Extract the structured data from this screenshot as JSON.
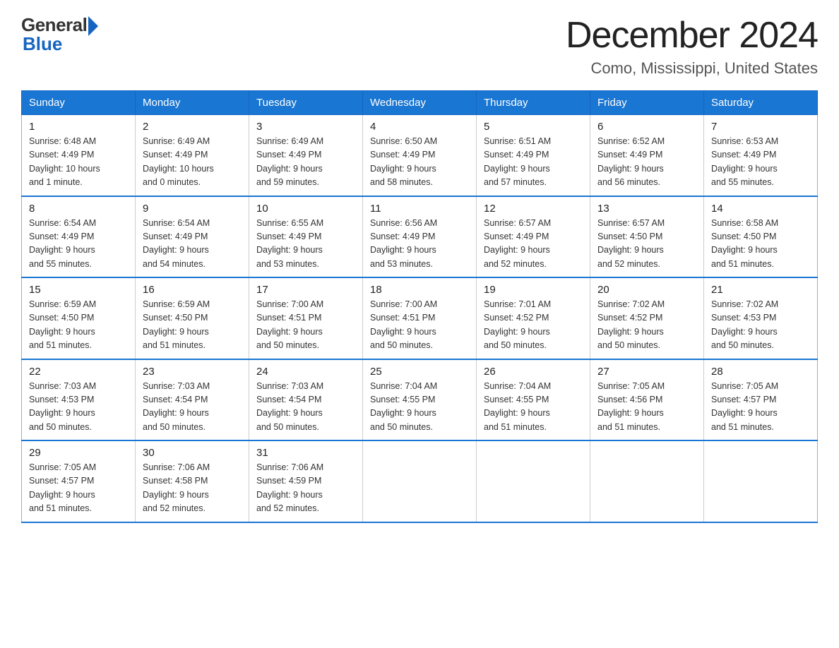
{
  "logo": {
    "general": "General",
    "blue": "Blue"
  },
  "header": {
    "month": "December 2024",
    "location": "Como, Mississippi, United States"
  },
  "weekdays": [
    "Sunday",
    "Monday",
    "Tuesday",
    "Wednesday",
    "Thursday",
    "Friday",
    "Saturday"
  ],
  "weeks": [
    [
      {
        "day": "1",
        "info": "Sunrise: 6:48 AM\nSunset: 4:49 PM\nDaylight: 10 hours\nand 1 minute."
      },
      {
        "day": "2",
        "info": "Sunrise: 6:49 AM\nSunset: 4:49 PM\nDaylight: 10 hours\nand 0 minutes."
      },
      {
        "day": "3",
        "info": "Sunrise: 6:49 AM\nSunset: 4:49 PM\nDaylight: 9 hours\nand 59 minutes."
      },
      {
        "day": "4",
        "info": "Sunrise: 6:50 AM\nSunset: 4:49 PM\nDaylight: 9 hours\nand 58 minutes."
      },
      {
        "day": "5",
        "info": "Sunrise: 6:51 AM\nSunset: 4:49 PM\nDaylight: 9 hours\nand 57 minutes."
      },
      {
        "day": "6",
        "info": "Sunrise: 6:52 AM\nSunset: 4:49 PM\nDaylight: 9 hours\nand 56 minutes."
      },
      {
        "day": "7",
        "info": "Sunrise: 6:53 AM\nSunset: 4:49 PM\nDaylight: 9 hours\nand 55 minutes."
      }
    ],
    [
      {
        "day": "8",
        "info": "Sunrise: 6:54 AM\nSunset: 4:49 PM\nDaylight: 9 hours\nand 55 minutes."
      },
      {
        "day": "9",
        "info": "Sunrise: 6:54 AM\nSunset: 4:49 PM\nDaylight: 9 hours\nand 54 minutes."
      },
      {
        "day": "10",
        "info": "Sunrise: 6:55 AM\nSunset: 4:49 PM\nDaylight: 9 hours\nand 53 minutes."
      },
      {
        "day": "11",
        "info": "Sunrise: 6:56 AM\nSunset: 4:49 PM\nDaylight: 9 hours\nand 53 minutes."
      },
      {
        "day": "12",
        "info": "Sunrise: 6:57 AM\nSunset: 4:49 PM\nDaylight: 9 hours\nand 52 minutes."
      },
      {
        "day": "13",
        "info": "Sunrise: 6:57 AM\nSunset: 4:50 PM\nDaylight: 9 hours\nand 52 minutes."
      },
      {
        "day": "14",
        "info": "Sunrise: 6:58 AM\nSunset: 4:50 PM\nDaylight: 9 hours\nand 51 minutes."
      }
    ],
    [
      {
        "day": "15",
        "info": "Sunrise: 6:59 AM\nSunset: 4:50 PM\nDaylight: 9 hours\nand 51 minutes."
      },
      {
        "day": "16",
        "info": "Sunrise: 6:59 AM\nSunset: 4:50 PM\nDaylight: 9 hours\nand 51 minutes."
      },
      {
        "day": "17",
        "info": "Sunrise: 7:00 AM\nSunset: 4:51 PM\nDaylight: 9 hours\nand 50 minutes."
      },
      {
        "day": "18",
        "info": "Sunrise: 7:00 AM\nSunset: 4:51 PM\nDaylight: 9 hours\nand 50 minutes."
      },
      {
        "day": "19",
        "info": "Sunrise: 7:01 AM\nSunset: 4:52 PM\nDaylight: 9 hours\nand 50 minutes."
      },
      {
        "day": "20",
        "info": "Sunrise: 7:02 AM\nSunset: 4:52 PM\nDaylight: 9 hours\nand 50 minutes."
      },
      {
        "day": "21",
        "info": "Sunrise: 7:02 AM\nSunset: 4:53 PM\nDaylight: 9 hours\nand 50 minutes."
      }
    ],
    [
      {
        "day": "22",
        "info": "Sunrise: 7:03 AM\nSunset: 4:53 PM\nDaylight: 9 hours\nand 50 minutes."
      },
      {
        "day": "23",
        "info": "Sunrise: 7:03 AM\nSunset: 4:54 PM\nDaylight: 9 hours\nand 50 minutes."
      },
      {
        "day": "24",
        "info": "Sunrise: 7:03 AM\nSunset: 4:54 PM\nDaylight: 9 hours\nand 50 minutes."
      },
      {
        "day": "25",
        "info": "Sunrise: 7:04 AM\nSunset: 4:55 PM\nDaylight: 9 hours\nand 50 minutes."
      },
      {
        "day": "26",
        "info": "Sunrise: 7:04 AM\nSunset: 4:55 PM\nDaylight: 9 hours\nand 51 minutes."
      },
      {
        "day": "27",
        "info": "Sunrise: 7:05 AM\nSunset: 4:56 PM\nDaylight: 9 hours\nand 51 minutes."
      },
      {
        "day": "28",
        "info": "Sunrise: 7:05 AM\nSunset: 4:57 PM\nDaylight: 9 hours\nand 51 minutes."
      }
    ],
    [
      {
        "day": "29",
        "info": "Sunrise: 7:05 AM\nSunset: 4:57 PM\nDaylight: 9 hours\nand 51 minutes."
      },
      {
        "day": "30",
        "info": "Sunrise: 7:06 AM\nSunset: 4:58 PM\nDaylight: 9 hours\nand 52 minutes."
      },
      {
        "day": "31",
        "info": "Sunrise: 7:06 AM\nSunset: 4:59 PM\nDaylight: 9 hours\nand 52 minutes."
      },
      {
        "day": "",
        "info": ""
      },
      {
        "day": "",
        "info": ""
      },
      {
        "day": "",
        "info": ""
      },
      {
        "day": "",
        "info": ""
      }
    ]
  ]
}
